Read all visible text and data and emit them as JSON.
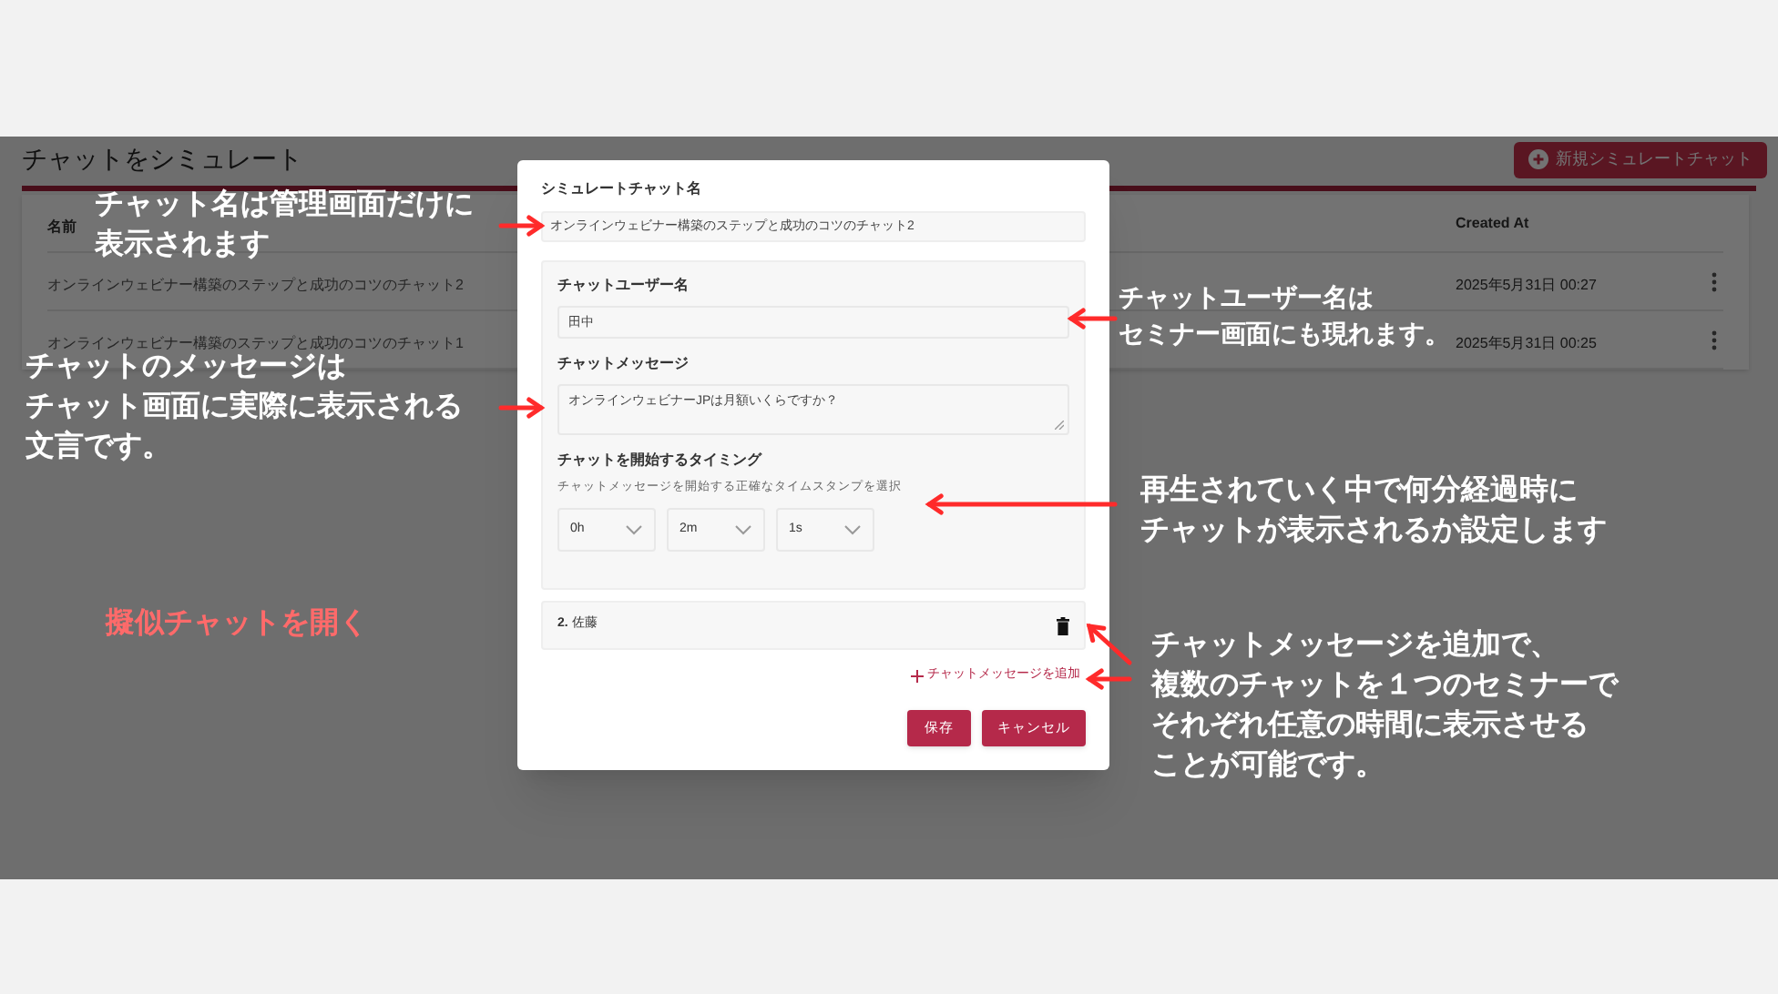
{
  "page": {
    "title": "チャットをシミュレート",
    "new_button": "新規シミュレートチャット",
    "table": {
      "columns": [
        "名前",
        "Created At"
      ],
      "rows": [
        {
          "name": "オンラインウェビナー構築のステップと成功のコツのチャット2",
          "created_at": "2025年5月31日 00:27"
        },
        {
          "name": "オンラインウェビナー構築のステップと成功のコツのチャット1",
          "created_at": "2025年5月31日 00:25"
        }
      ]
    }
  },
  "modal": {
    "name_label": "シミュレートチャット名",
    "name_value": "オンラインウェビナー構築のステップと成功のコツのチャット2",
    "message": {
      "user_label": "チャットユーザー名",
      "user_value": "田中",
      "message_label": "チャットメッセージ",
      "message_value": "オンラインウェビナーJPは月額いくらですか？",
      "timing_label": "チャットを開始するタイミング",
      "timing_hint": "チャットメッセージを開始する正確なタイムスタンプを選択",
      "selects": [
        "0h",
        "2m",
        "1s"
      ]
    },
    "collapsed_item": "**2.** 佐藤",
    "add_link": "チャットメッセージを追加",
    "buttons": [
      "保存",
      "キャンセル"
    ]
  },
  "annotations": [
    {
      "kind": "note",
      "lines": [
        "チャット名は管理画面だけに",
        "表示されます"
      ]
    },
    {
      "kind": "note",
      "lines": [
        "チャットのメッセージは",
        "チャット画面に実際に表示される",
        "文言です。"
      ]
    },
    {
      "kind": "note",
      "lines": [
        "チャットユーザー名は",
        "セミナー画面にも現れます。"
      ]
    },
    {
      "kind": "note",
      "lines": [
        "再生されていく中で何分経過時に",
        "チャットが表示されるか設定します"
      ]
    },
    {
      "kind": "heading",
      "lines": [
        "擬似チャットを開く"
      ]
    },
    {
      "kind": "note",
      "lines": [
        "チャットメッセージを追加で、",
        "複数のチャットを１つのセミナーで",
        "それぞれ任意の時間に表示させる",
        "ことが可能です。"
      ]
    }
  ]
}
